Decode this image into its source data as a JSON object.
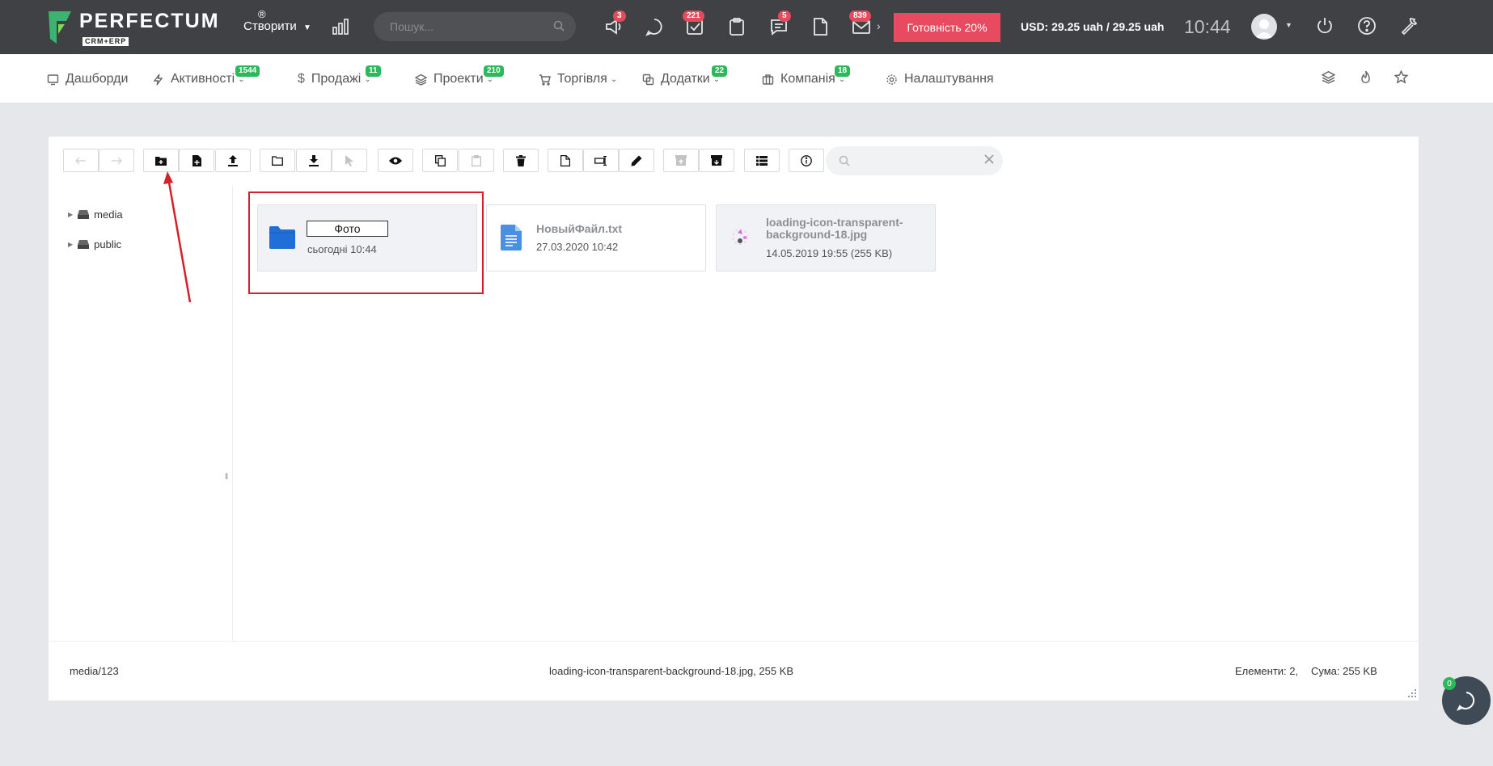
{
  "brand": {
    "name": "PERFECTUM",
    "sub": "CRM+ERP",
    "reg": "®"
  },
  "header": {
    "create_label": "Створити",
    "search_placeholder": "Пошук...",
    "badges": {
      "announcements": "3",
      "tasks": "221",
      "messages": "5",
      "mail": "839"
    },
    "ready_label": "Готовність 20%",
    "currency": "USD: 29.25 uah / 29.25 uah",
    "time": "10:44"
  },
  "nav": {
    "items": [
      {
        "label": "Дашборди",
        "icon": "dashboard-icon"
      },
      {
        "label": "Активності",
        "icon": "bolt-icon",
        "badge": "1544"
      },
      {
        "label": "Продажі",
        "icon": "dollar-icon",
        "badge": "11"
      },
      {
        "label": "Проекти",
        "icon": "layers-icon",
        "badge": "210"
      },
      {
        "label": "Торгівля",
        "icon": "cart-icon"
      },
      {
        "label": "Додатки",
        "icon": "copy-icon",
        "badge": "22"
      },
      {
        "label": "Компанія",
        "icon": "briefcase-icon",
        "badge": "18"
      },
      {
        "label": "Налаштування",
        "icon": "gear-icon"
      }
    ]
  },
  "tree": {
    "items": [
      {
        "label": "media"
      },
      {
        "label": "public"
      }
    ]
  },
  "files": [
    {
      "name": "Фото",
      "meta": "сьогодні 10:44",
      "type": "folder",
      "renaming": true
    },
    {
      "name": "НовыйФайл.txt",
      "meta": "27.03.2020 10:42",
      "type": "text"
    },
    {
      "name": "loading-icon-transparent-background-18.jpg",
      "name_line1": "loading-icon-transparent-",
      "name_line2": "background-18.jpg",
      "meta": "14.05.2019 19:55 (255 KB)",
      "type": "image"
    }
  ],
  "status": {
    "path": "media/123",
    "selected": "loading-icon-transparent-background-18.jpg, 255 KB",
    "count": "Елементи: 2,",
    "total": "Сума: 255 KB"
  },
  "chat": {
    "badge": "0"
  },
  "colors": {
    "topbar": "#3f4144",
    "accent": "#e84a5f",
    "badge_green": "#2eb85c",
    "highlight": "#d4202a"
  }
}
